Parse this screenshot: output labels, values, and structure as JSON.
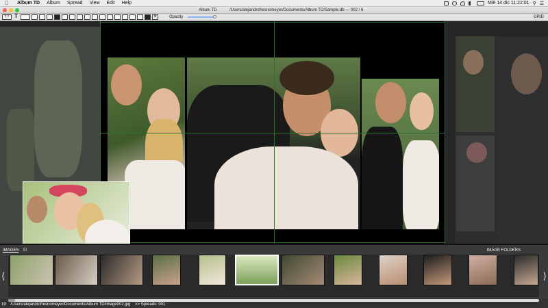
{
  "menubar": {
    "apple_icon": "apple-icon",
    "items": [
      "Album TD",
      "Album",
      "Spread",
      "View",
      "Edit",
      "Help"
    ],
    "clock": "Miè 14 dic  11:22:01"
  },
  "titlebar": {
    "app_name": "Album TD",
    "path": "/Users/alejandrofresnomeyer/Documents/Album TD/Sample.db  ---  002 / 6"
  },
  "toolbar": {
    "first_button": "?;?",
    "text_button": "T",
    "opacity_label": "Opacity",
    "opacity_level": 1.0,
    "grid_label": "GRID"
  },
  "browser": {
    "tabs": [
      "IMAGES",
      "SI"
    ],
    "folders_label": "IMAGE FOLDERS",
    "left_arrow": "⟨",
    "right_arrow": "⟩"
  },
  "statusbar": {
    "index": "19",
    "path": "/Users/alejandrofresnomeyer/Documents/Album TD/image002.jpg",
    "spreads": ">>  Spreads: 001"
  },
  "colors": {
    "menubar_bg": "#ececec",
    "canvas_bg": "#000000",
    "guide": "#2f6f2f",
    "browser_bg": "#3a3a3a"
  }
}
